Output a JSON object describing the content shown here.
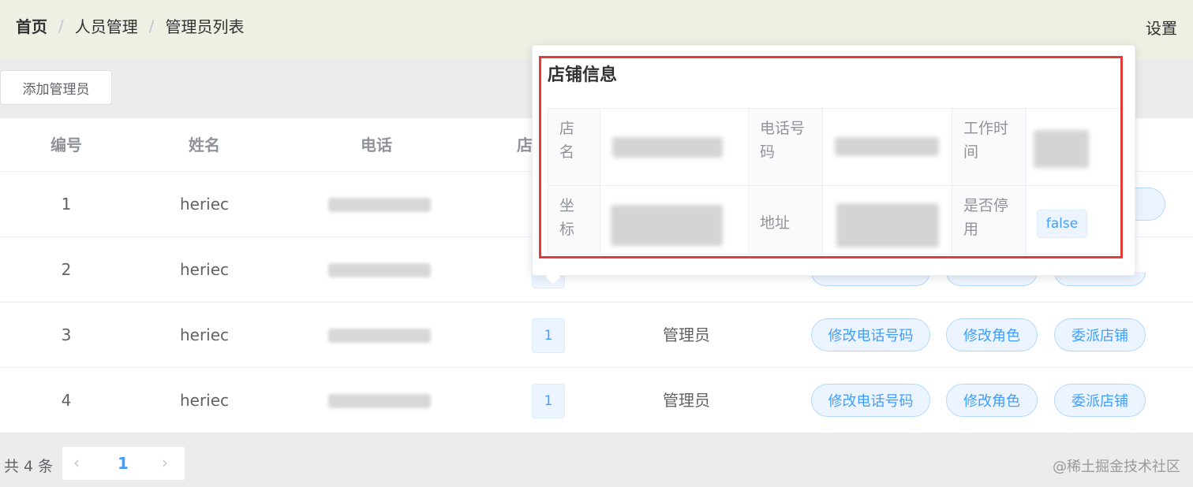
{
  "breadcrumb": [
    "首页",
    "人员管理",
    "管理员列表"
  ],
  "breadcrumb_separator": "/",
  "settings_label": "设置",
  "add_button_label": "添加管理员",
  "table": {
    "headers": {
      "id": "编号",
      "name": "姓名",
      "phone": "电话",
      "shop": "店"
    },
    "rows": [
      {
        "id": "1",
        "name": "heriec",
        "shop": "",
        "role": ""
      },
      {
        "id": "2",
        "name": "heriec",
        "shop": "",
        "role": ""
      },
      {
        "id": "3",
        "name": "heriec",
        "shop": "1",
        "role": "管理员"
      },
      {
        "id": "4",
        "name": "heriec",
        "shop": "1",
        "role": "管理员"
      }
    ],
    "actions": {
      "edit_phone": "修改电话号码",
      "edit_role": "修改角色",
      "assign_shop": "委派店铺"
    }
  },
  "pagination": {
    "total_text": "共 4 条",
    "prev_icon": "chevron-left-icon",
    "current_page": "1",
    "next_icon": "chevron-right-icon"
  },
  "popover": {
    "title": "店铺信息",
    "labels": {
      "shop_name": "店名",
      "phone": "电话号码",
      "work_time": "工作时间",
      "coordinates": "坐标",
      "address": "地址",
      "disabled": "是否停用"
    },
    "disabled_value": "false"
  },
  "watermark": "@稀土掘金技术社区",
  "colors": {
    "accent": "#409eff",
    "highlight": "#e33a3a",
    "header_bg": "#eef0e4"
  }
}
